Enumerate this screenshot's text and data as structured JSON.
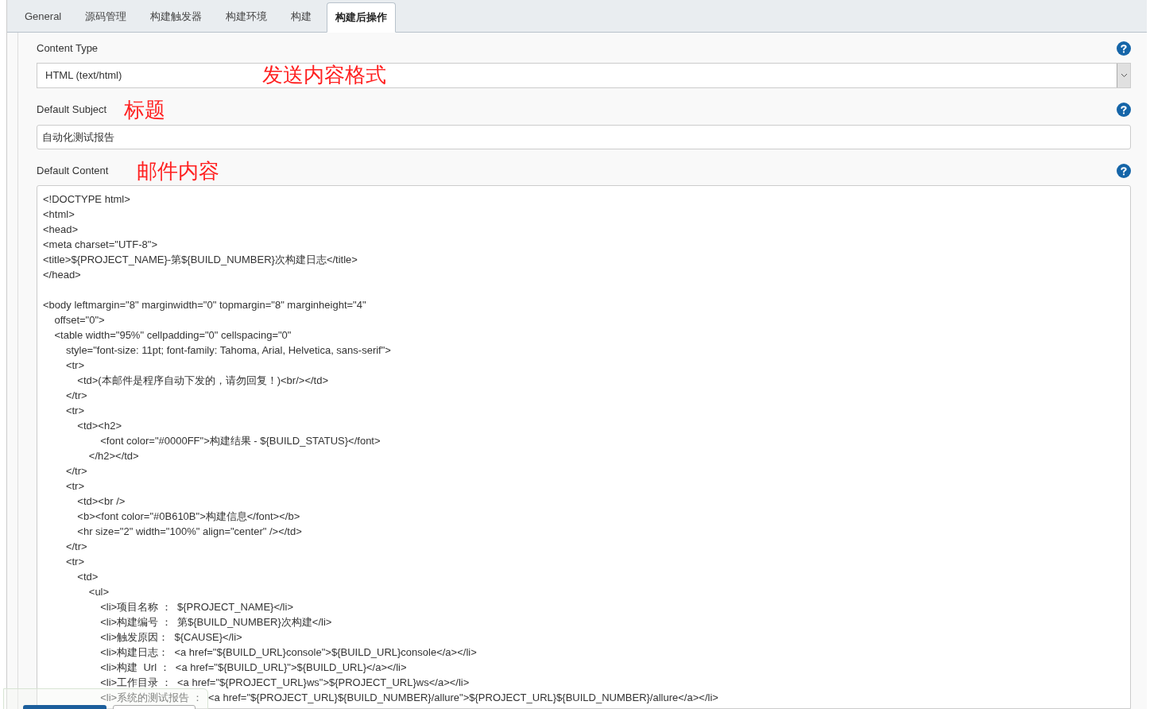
{
  "tabs": [
    {
      "label": "General",
      "selected": false
    },
    {
      "label": "源码管理",
      "selected": false
    },
    {
      "label": "构建触发器",
      "selected": false
    },
    {
      "label": "构建环境",
      "selected": false
    },
    {
      "label": "构建",
      "selected": false
    },
    {
      "label": "构建后操作",
      "selected": true
    }
  ],
  "content_type": {
    "label": "Content Type",
    "value": "HTML (text/html)",
    "annotation": "发送内容格式"
  },
  "default_subject": {
    "label": "Default Subject",
    "value": "自动化测试报告",
    "annotation": "标题"
  },
  "default_content": {
    "label": "Default Content",
    "annotation": "邮件内容",
    "blocks": [
      [
        "<!DOCTYPE html>",
        "<html>",
        "<head>",
        "<meta charset=\"UTF-8\">",
        "<title>${PROJECT_NAME}-第${BUILD_NUMBER}次构建日志</title>",
        "</head>"
      ],
      [
        "<body leftmargin=\"8\" marginwidth=\"0\" topmargin=\"8\" marginheight=\"4\"",
        "    offset=\"0\">",
        "    <table width=\"95%\" cellpadding=\"0\" cellspacing=\"0\"",
        "        style=\"font-size: 11pt; font-family: Tahoma, Arial, Helvetica, sans-serif\">",
        "        <tr>",
        "            <td>(本邮件是程序自动下发的，请勿回复！)<br/></td>",
        "        </tr>",
        "        <tr>",
        "            <td><h2>",
        "                    <font color=\"#0000FF\">构建结果 - ${BUILD_STATUS}</font>",
        "                </h2></td>",
        "        </tr>",
        "        <tr>",
        "            <td><br />",
        "            <b><font color=\"#0B610B\">构建信息</font></b>",
        "            <hr size=\"2\" width=\"100%\" align=\"center\" /></td>",
        "        </tr>",
        "        <tr>",
        "            <td>",
        "                <ul>",
        "                    <li>项目名称 ：  ${PROJECT_NAME}</li>",
        "                    <li>构建编号 ：  第${BUILD_NUMBER}次构建</li>",
        "                    <li>触发原因：  ${CAUSE}</li>",
        "                    <li>构建日志：  <a href=\"${BUILD_URL}console\">${BUILD_URL}console</a></li>",
        "                    <li>构建  Url ：  <a href=\"${BUILD_URL}\">${BUILD_URL}</a></li>",
        "                    <li>工作目录 ：  <a href=\"${PROJECT_URL}ws\">${PROJECT_URL}ws</a></li>",
        "                    <li>系统的测试报告 ：  <a href=\"${PROJECT_URL}${BUILD_NUMBER}/allure\">${PROJECT_URL}${BUILD_NUMBER}/allure</a></li>"
      ]
    ]
  }
}
